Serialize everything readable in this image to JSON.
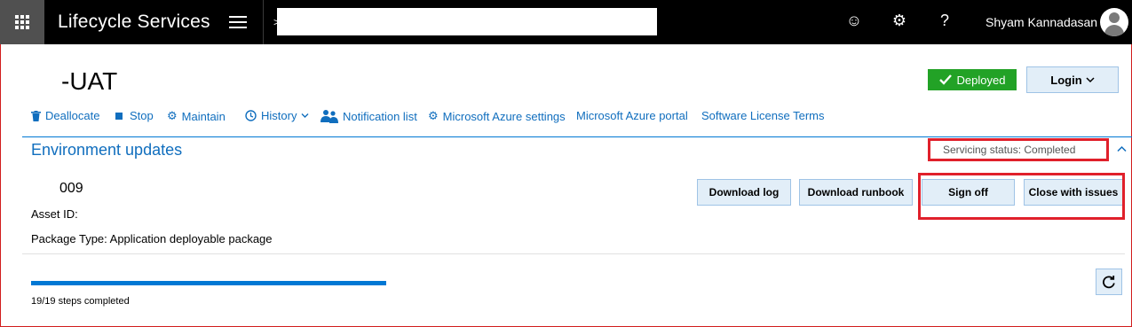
{
  "header": {
    "app_title": "Lifecycle Services",
    "search_prefix": ">",
    "user_name": "Shyam Kannadasan",
    "icons": [
      "waffle-icon",
      "hamburger-icon",
      "smiley-icon",
      "gear-icon",
      "help-icon",
      "avatar-icon"
    ]
  },
  "environment": {
    "title": "-UAT",
    "status_badge": "Deployed",
    "login_label": "Login"
  },
  "toolbar": {
    "items": [
      {
        "label": "Deallocate",
        "icon": "trash-icon"
      },
      {
        "label": "Stop",
        "icon": "stop-icon"
      },
      {
        "label": "Maintain",
        "icon": "gears-icon"
      },
      {
        "label": "History",
        "icon": "clock-icon"
      },
      {
        "label": "Notification list",
        "icon": "people-icon"
      },
      {
        "label": "Microsoft Azure settings",
        "icon": "gear-icon"
      },
      {
        "label": "Microsoft Azure portal",
        "icon": ""
      },
      {
        "label": "Software License Terms",
        "icon": ""
      }
    ]
  },
  "updates": {
    "section_title": "Environment updates",
    "servicing_status": "Servicing status: Completed",
    "package_name": "009",
    "asset_id_label": "Asset ID:",
    "package_type": "Package Type: Application deployable package",
    "buttons": {
      "download_log": "Download log",
      "download_runbook": "Download runbook",
      "sign_off": "Sign off",
      "close_with_issues": "Close with issues"
    },
    "progress_fraction": 1.0,
    "steps_text": "19/19 steps completed"
  },
  "colors": {
    "accent": "#0078d4",
    "link": "#106ebe",
    "success": "#22a226",
    "highlight": "#e0202b",
    "button_bg": "#e2eef8"
  }
}
